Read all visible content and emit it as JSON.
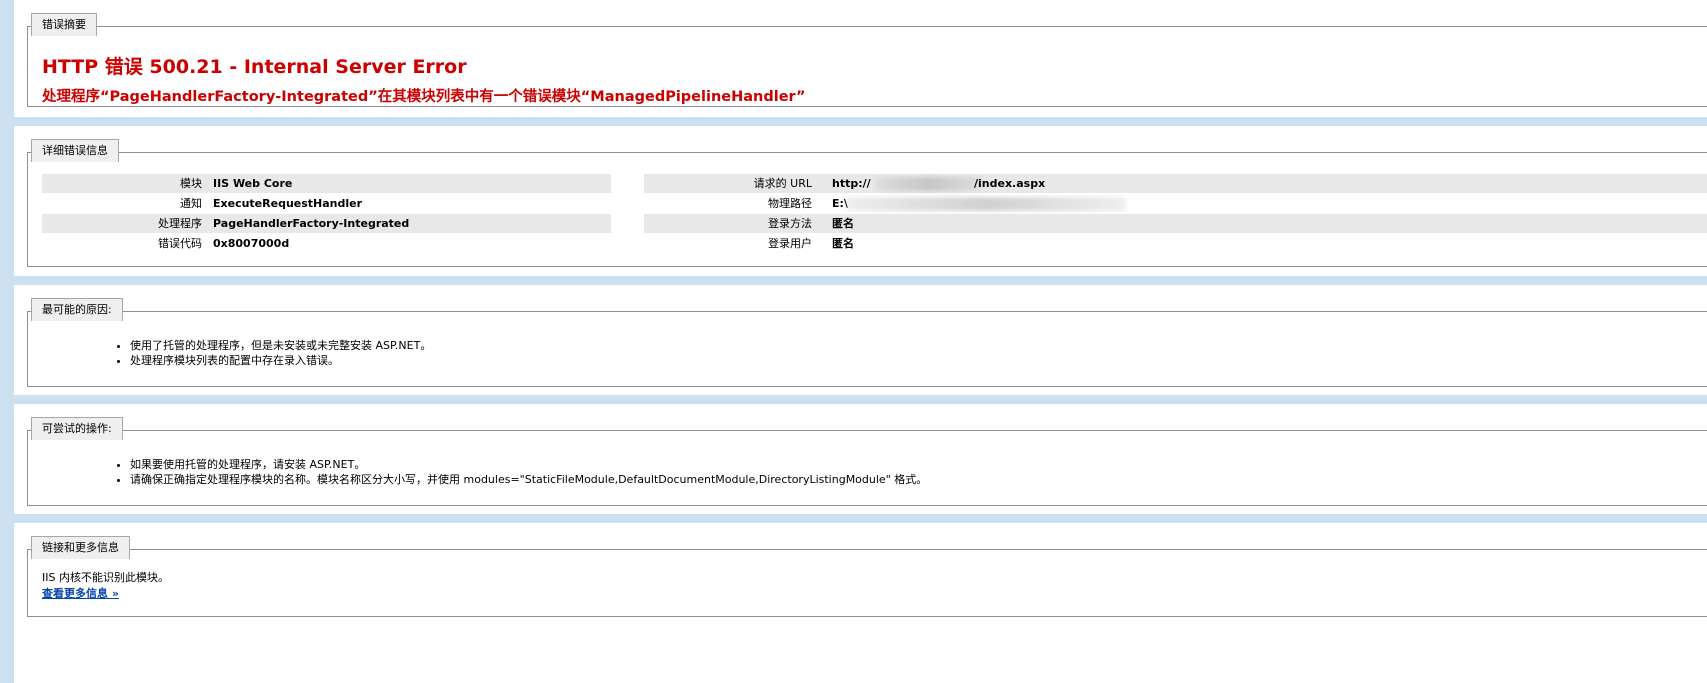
{
  "summary": {
    "legend": "错误摘要",
    "title": "HTTP 错误 500.21 - Internal Server Error",
    "subtitle": "处理程序“PageHandlerFactory-Integrated”在其模块列表中有一个错误模块“ManagedPipelineHandler”"
  },
  "details": {
    "legend": "详细错误信息",
    "left": [
      {
        "label": "模块",
        "value": "IIS Web Core"
      },
      {
        "label": "通知",
        "value": "ExecuteRequestHandler"
      },
      {
        "label": "处理程序",
        "value": "PageHandlerFactory-Integrated"
      },
      {
        "label": "错误代码",
        "value": "0x8007000d"
      }
    ],
    "right": [
      {
        "label": "请求的 URL",
        "value_prefix": "http://",
        "value_suffix": "/index.aspx"
      },
      {
        "label": "物理路径",
        "value_prefix": "E:\\",
        "value_suffix": ""
      },
      {
        "label": "登录方法",
        "value_prefix": "匿名",
        "value_suffix": ""
      },
      {
        "label": "登录用户",
        "value_prefix": "匿名",
        "value_suffix": ""
      }
    ]
  },
  "causes": {
    "legend": "最可能的原因:",
    "items": [
      "使用了托管的处理程序，但是未安装或未完整安装 ASP.NET。",
      "处理程序模块列表的配置中存在录入错误。"
    ]
  },
  "actions": {
    "legend": "可尝试的操作:",
    "items": [
      "如果要使用托管的处理程序，请安装 ASP.NET。",
      "请确保正确指定处理程序模块的名称。模块名称区分大小写，并使用 modules=\"StaticFileModule,DefaultDocumentModule,DirectoryListingModule\" 格式。"
    ]
  },
  "links": {
    "legend": "链接和更多信息",
    "text": "IIS 内核不能识别此模块。",
    "more_link": "查看更多信息 »"
  },
  "colors": {
    "page_background": "#cbe1ef",
    "error_red": "#cc0000",
    "row_alt": "#e8e8e8",
    "link_blue": "#0645ad"
  }
}
